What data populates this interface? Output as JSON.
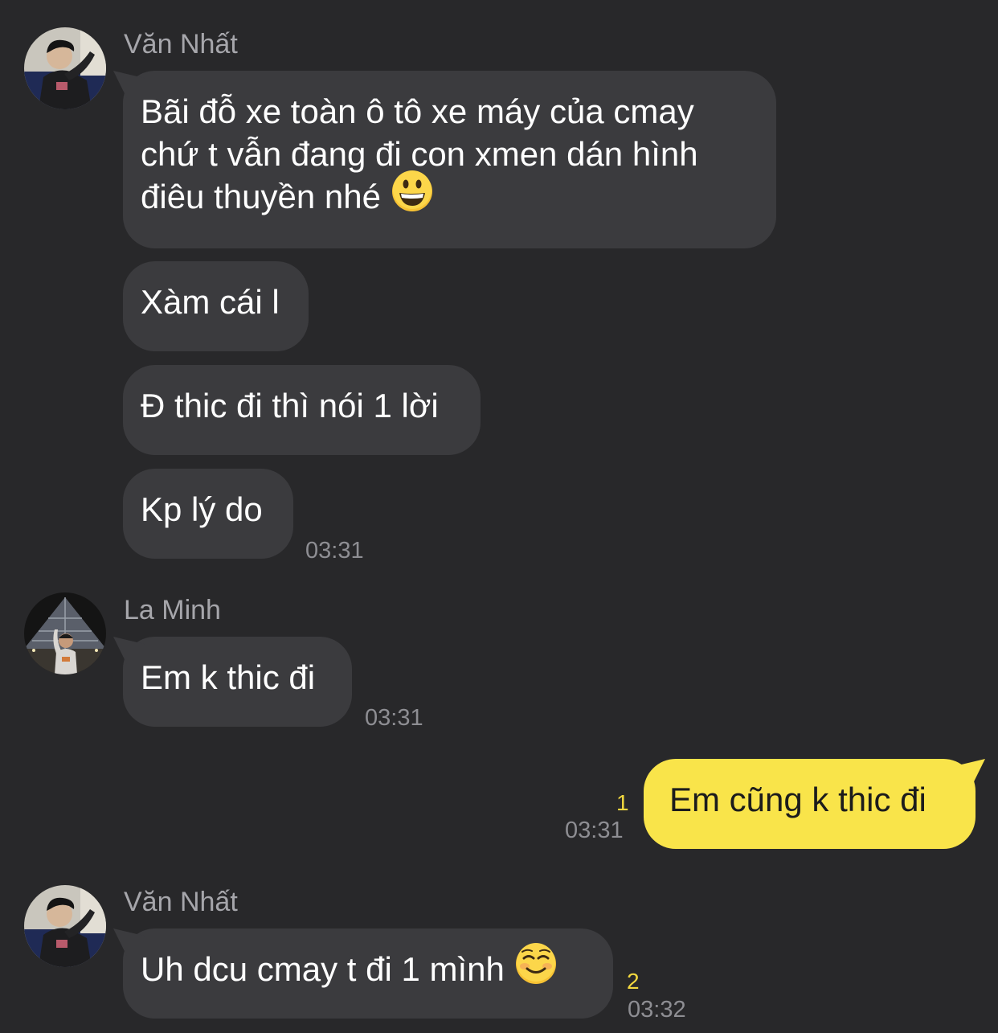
{
  "group1": {
    "sender": "Văn Nhất",
    "avatar_icon": "avatar-van-nhat",
    "message1_lines": [
      "Bãi đỗ xe toàn ô tô xe máy của cmay",
      "chứ t vẫn đang đi con xmen dán hình",
      "điêu thuyền nhé"
    ],
    "message1_emoji": "grinning-face-emoji",
    "message2": "Xàm cái l",
    "message3": "Đ thic đi thì nói 1 lời",
    "message4": "Kp lý do",
    "time": "03:31"
  },
  "group2": {
    "sender": "La Minh",
    "avatar_icon": "avatar-la-minh",
    "message": "Em k thic đi",
    "time": "03:31"
  },
  "outgoing": {
    "message": "Em cũng k thic đi",
    "unread_count": "1",
    "time": "03:31"
  },
  "group3": {
    "sender": "Văn Nhất",
    "avatar_icon": "avatar-van-nhat",
    "message": "Uh dcu cmay t đi 1 mình",
    "message_emoji": "smiling-face-emoji",
    "unread_count": "2",
    "time": "03:32"
  },
  "colors": {
    "background": "#28282a",
    "incoming_bubble": "#3b3b3e",
    "outgoing_bubble": "#f9e44a",
    "sender_name": "#a6a6ab",
    "timestamp": "#8e8e93",
    "unread_count": "#f2d83f"
  }
}
